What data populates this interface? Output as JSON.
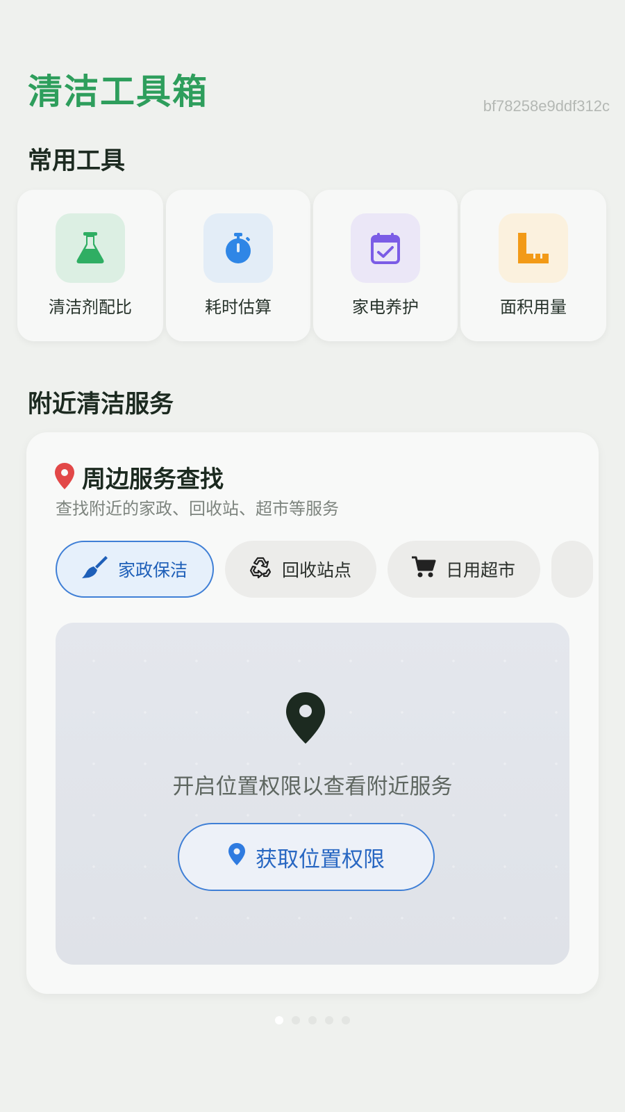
{
  "header": {
    "title": "清洁工具箱",
    "build_id": "bf78258e9ddf312c"
  },
  "tools_section": {
    "title": "常用工具",
    "items": [
      {
        "label": "清洁剂配比",
        "icon": "flask-icon",
        "color": "#2fae63",
        "bg": "#dcefe3"
      },
      {
        "label": "耗时估算",
        "icon": "stopwatch-icon",
        "color": "#2f86e6",
        "bg": "#e3edf7"
      },
      {
        "label": "家电养护",
        "icon": "calendar-check-icon",
        "color": "#7b5ce6",
        "bg": "#ebe7f7"
      },
      {
        "label": "面积用量",
        "icon": "ruler-icon",
        "color": "#f29a17",
        "bg": "#fbf1de"
      }
    ]
  },
  "nearby_section": {
    "title": "附近清洁服务",
    "card": {
      "title": "周边服务查找",
      "subtitle": "查找附近的家政、回收站、超市等服务",
      "pin_color": "#e24848",
      "chips": [
        {
          "label": "家政保洁",
          "icon": "broom-icon",
          "active": true
        },
        {
          "label": "回收站点",
          "icon": "recycle-icon",
          "active": false
        },
        {
          "label": "日用超市",
          "icon": "cart-icon",
          "active": false
        }
      ],
      "map": {
        "message": "开启位置权限以查看附近服务",
        "button_label": "获取位置权限",
        "accent": "#3f7fd6"
      }
    }
  },
  "pager": {
    "count": 5,
    "active": 0
  }
}
